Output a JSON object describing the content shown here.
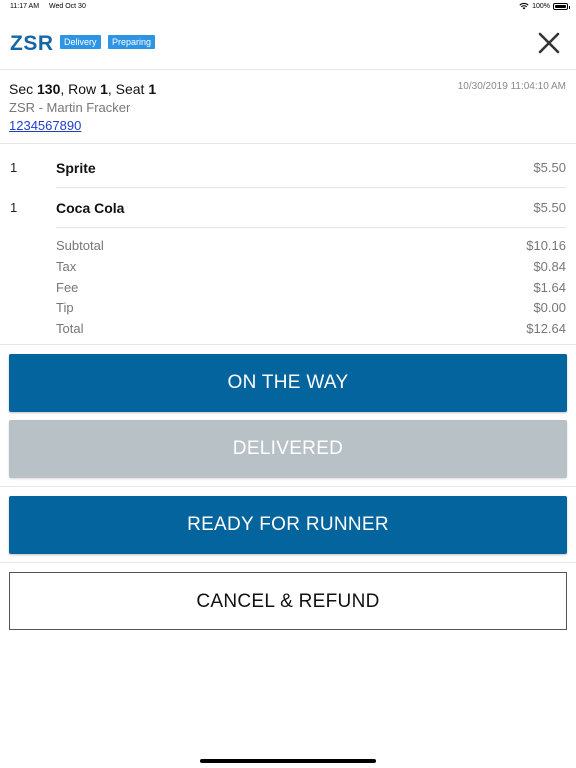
{
  "status_bar": {
    "time": "11:17 AM",
    "date": "Wed Oct 30",
    "battery_percent": "100%",
    "battery_level": 1.0,
    "wifi_icon": "wifi-icon"
  },
  "header": {
    "brand": "ZSR",
    "badges": [
      "Delivery",
      "Preparing"
    ],
    "close_icon": "close-icon",
    "badge_color": "#2d95e4",
    "brand_color": "#1467a4"
  },
  "order": {
    "seat": {
      "sec_label": "Sec",
      "sec": "130",
      "row_label": ", Row",
      "row": "1",
      "seat_label": ", Seat",
      "seat": "1"
    },
    "timestamp": "10/30/2019 11:04:10 AM",
    "customer": "ZSR - Martin Fracker",
    "phone": "1234567890"
  },
  "items": [
    {
      "qty": "1",
      "name": "Sprite",
      "price": "$5.50"
    },
    {
      "qty": "1",
      "name": "Coca Cola",
      "price": "$5.50"
    }
  ],
  "summary": [
    {
      "label": "Subtotal",
      "value": "$10.16"
    },
    {
      "label": "Tax",
      "value": "$0.84"
    },
    {
      "label": "Fee",
      "value": "$1.64"
    },
    {
      "label": "Tip",
      "value": "$0.00"
    },
    {
      "label": "Total",
      "value": "$12.64"
    }
  ],
  "actions": {
    "on_the_way": "ON THE WAY",
    "delivered": "DELIVERED",
    "ready_for_runner": "READY FOR RUNNER",
    "cancel_refund": "CANCEL & REFUND",
    "primary_color": "#04649e",
    "disabled_color": "#b7c1c6"
  }
}
